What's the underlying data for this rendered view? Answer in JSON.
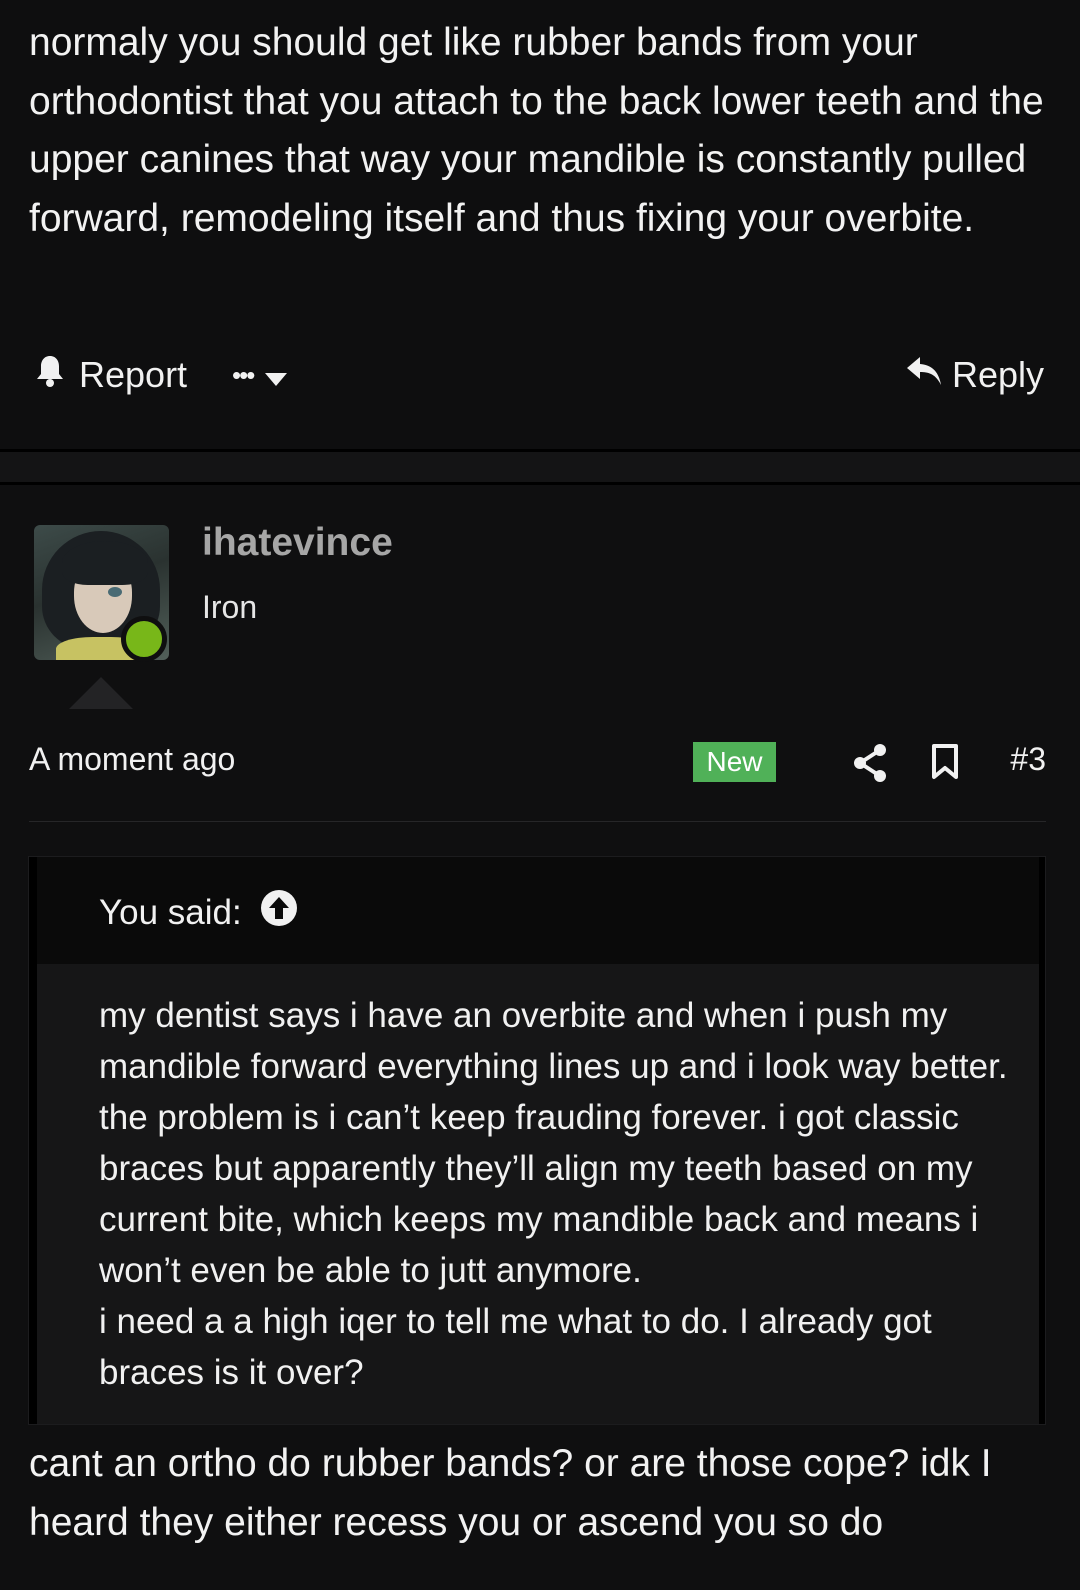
{
  "previous_post": {
    "body": "normaly you should get like rubber bands from your orthodontist that you attach to the back lower teeth and the upper canines that way your mandible is constantly pulled forward, remodeling itself and thus fixing your overbite.",
    "actions": {
      "report_label": "Report",
      "more_label": "•••",
      "reply_label": "Reply"
    }
  },
  "post": {
    "author": {
      "username": "ihatevince",
      "user_title": "Iron",
      "online": true
    },
    "timestamp": "A moment ago",
    "new_badge": "New",
    "post_number": "#3",
    "quote": {
      "header_label": "You said:",
      "text": "my dentist says i have an overbite and when i push my mandible forward everything lines up and i look way better. the problem is i can’t keep frauding forever. i got classic braces but apparently they’ll align my teeth based on my current bite, which keeps my mandible back and means i won’t even be able to jutt anymore.\ni need a a high iqer to tell me what to do. I already got braces is it over?"
    },
    "body": "cant an ortho do rubber bands? or are those cope? idk I heard they either recess you or ascend you so do"
  },
  "colors": {
    "background": "#0e0e0f",
    "username": "#a6a6a6",
    "online_dot": "#78b719",
    "new_badge": "#50b158"
  },
  "icons": {
    "report": "bell-icon",
    "more": "ellipsis-icon",
    "dropdown": "caret-down-icon",
    "reply": "reply-arrow-icon",
    "share": "share-icon",
    "bookmark": "bookmark-icon",
    "quote_jump": "arrow-up-circle-icon"
  }
}
